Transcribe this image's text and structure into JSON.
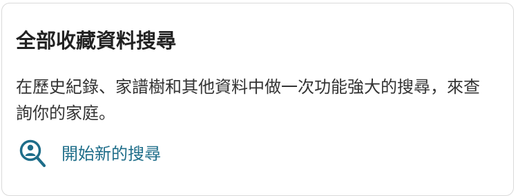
{
  "card": {
    "title": "全部收藏資料搜尋",
    "description": "在歷史紀錄、家譜樹和其他資料中做一次功能強大的搜尋，來查詢你的家庭。",
    "link": {
      "icon": "person-search-icon",
      "label": "開始新的搜尋"
    }
  },
  "colors": {
    "link": "#1e6d89",
    "title": "#222222",
    "text": "#333333",
    "border": "#d9d9d9"
  }
}
